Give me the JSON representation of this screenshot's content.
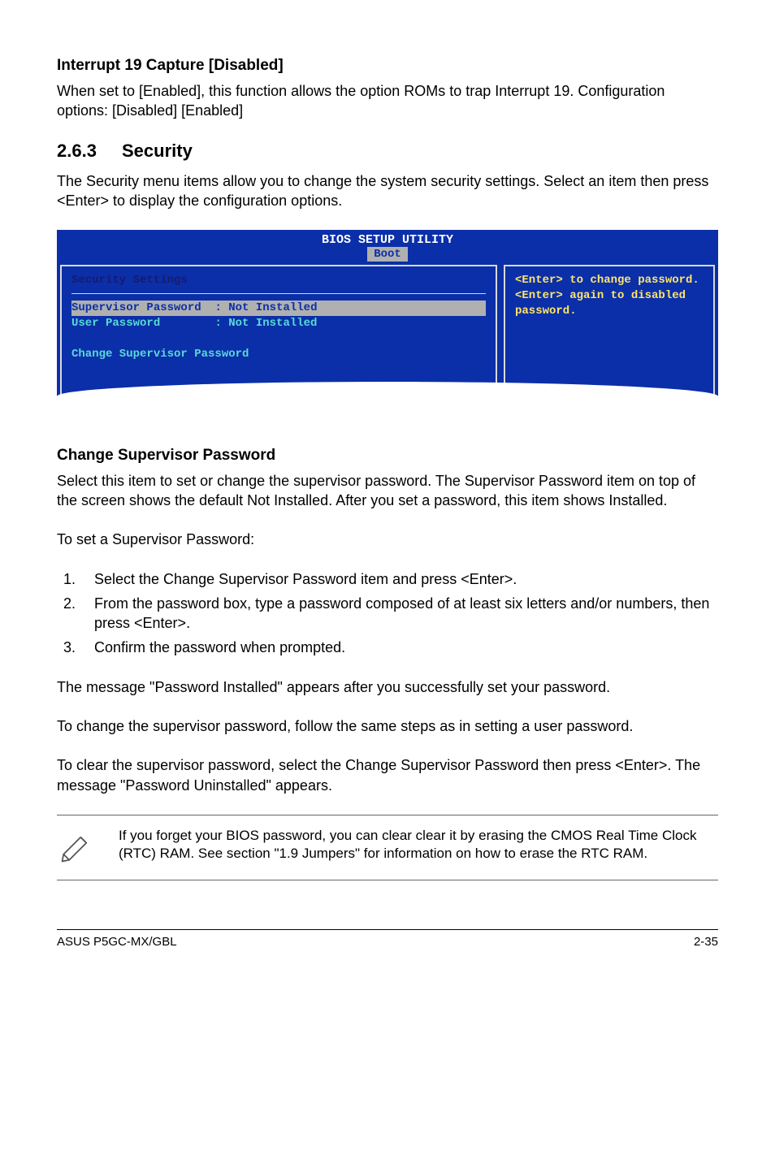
{
  "sec1": {
    "heading": "Interrupt 19 Capture [Disabled]",
    "para": "When set to [Enabled], this function allows the option ROMs to trap Interrupt 19. Configuration options: [Disabled] [Enabled]"
  },
  "sec2": {
    "num": "2.6.3",
    "title": "Security",
    "para": "The Security menu items allow you to change the system security settings. Select an item then press <Enter> to display the configuration options."
  },
  "bios": {
    "title": "BIOS SETUP UTILITY",
    "tab": "Boot",
    "left_heading": "Security Settings",
    "row1_label": "Supervisor Password",
    "row1_value": ": Not Installed",
    "row2_label": "User Password",
    "row2_value": ": Not Installed",
    "change": "Change Supervisor Password",
    "help1": "<Enter> to change password.",
    "help2": "<Enter> again to disabled password."
  },
  "sec3": {
    "heading": "Change Supervisor Password",
    "para1": "Select this item to set or change the supervisor password. The Supervisor Password item on top of the screen shows the default Not Installed. After you set a password, this item shows Installed.",
    "para2": "To set a Supervisor Password:",
    "steps": [
      "Select the Change Supervisor Password item and press <Enter>.",
      "From the password box, type a password composed of at least six letters and/or numbers, then press <Enter>.",
      "Confirm the password when prompted."
    ],
    "para3": "The message \"Password Installed\" appears after you successfully set your password.",
    "para4": "To change the supervisor password, follow the same steps as in setting a user password.",
    "para5": "To clear the supervisor password, select the Change Supervisor Password then press <Enter>. The message \"Password Uninstalled\" appears."
  },
  "note": {
    "text": "If you forget your BIOS password, you can clear clear it by erasing the CMOS Real Time Clock (RTC) RAM. See section \"1.9 Jumpers\" for information on how to erase the RTC RAM."
  },
  "footer": {
    "left": "ASUS P5GC-MX/GBL",
    "right": "2-35"
  }
}
